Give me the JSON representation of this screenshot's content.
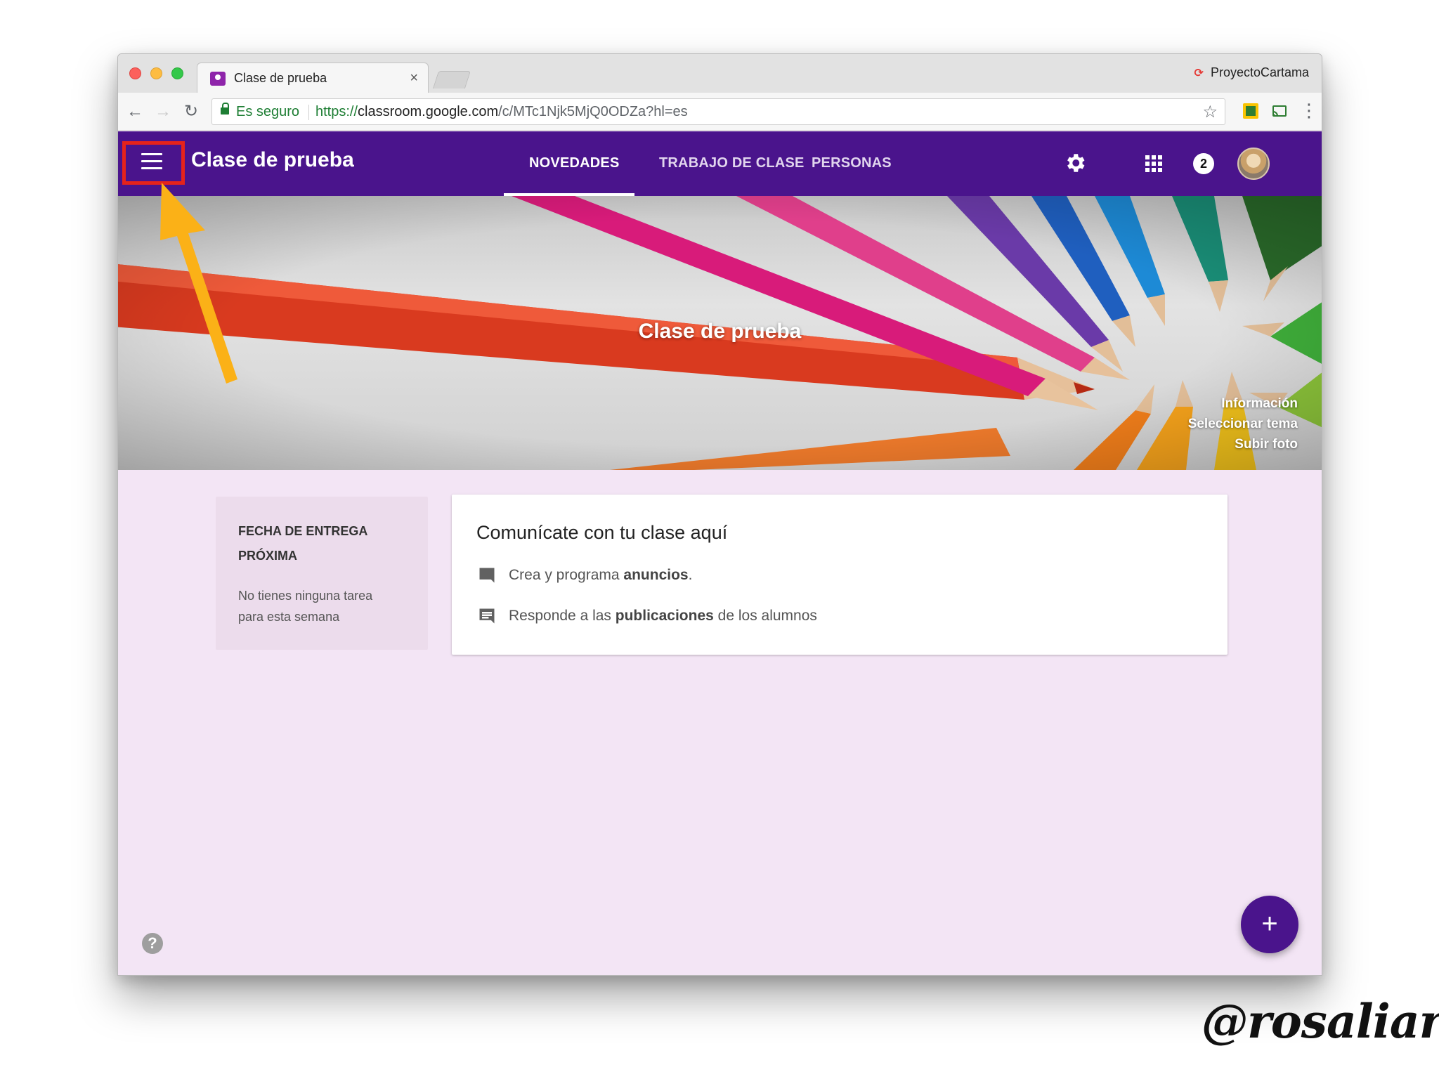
{
  "browser": {
    "tab_title": "Clase de prueba",
    "tab_close": "×",
    "profile_name": "ProyectoCartama",
    "secure_label": "Es seguro",
    "url_scheme": "https://",
    "url_host": "classroom.google.com",
    "url_path": "/c/MTc1Njk5MjQ0ODZa?hl=es"
  },
  "header": {
    "class_title": "Clase de prueba",
    "tabs": [
      {
        "label": "NOVEDADES",
        "active": true
      },
      {
        "label": "TRABAJO DE CLASE",
        "active": false
      },
      {
        "label": "PERSONAS",
        "active": false
      }
    ],
    "notification_count": "2",
    "accent_color": "#4a148c"
  },
  "banner": {
    "title": "Clase de prueba",
    "links": [
      "Información",
      "Seleccionar tema",
      "Subir foto"
    ]
  },
  "upcoming": {
    "title": "FECHA DE ENTREGA PRÓXIMA",
    "text": "No tienes ninguna tarea para esta semana"
  },
  "share": {
    "title": "Comunícate con tu clase aquí",
    "row1": {
      "before": "Crea y programa ",
      "bold": "anuncios",
      "after": "."
    },
    "row2": {
      "before": "Responde a las ",
      "bold": "publicaciones",
      "after": " de los alumnos"
    }
  },
  "fab": {
    "label": "+"
  },
  "help": {
    "label": "?"
  },
  "watermark": "@rosaliarte",
  "icons": {
    "menu": "hamburger-icon",
    "settings": "gear-icon",
    "apps": "apps-grid-icon",
    "announce": "chat-bubble-icon",
    "comments": "comment-icon"
  }
}
